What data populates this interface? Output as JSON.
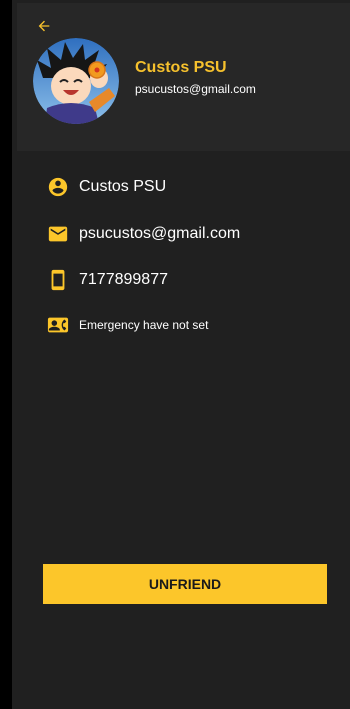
{
  "header": {
    "name": "Custos PSU",
    "email": "psucustos@gmail.com"
  },
  "details": [
    {
      "icon": "account-circle-icon",
      "value": "Custos PSU"
    },
    {
      "icon": "email-icon",
      "value": "psucustos@gmail.com"
    },
    {
      "icon": "phone-icon",
      "value": "7177899877"
    },
    {
      "icon": "emergency-contact-icon",
      "value": "Emergency have not set"
    }
  ],
  "actions": {
    "unfriend_label": "UNFRIEND"
  },
  "colors": {
    "accent": "#fcc62a",
    "name_accent": "#f6c12d",
    "background": "#202020",
    "header_background": "#272727"
  }
}
